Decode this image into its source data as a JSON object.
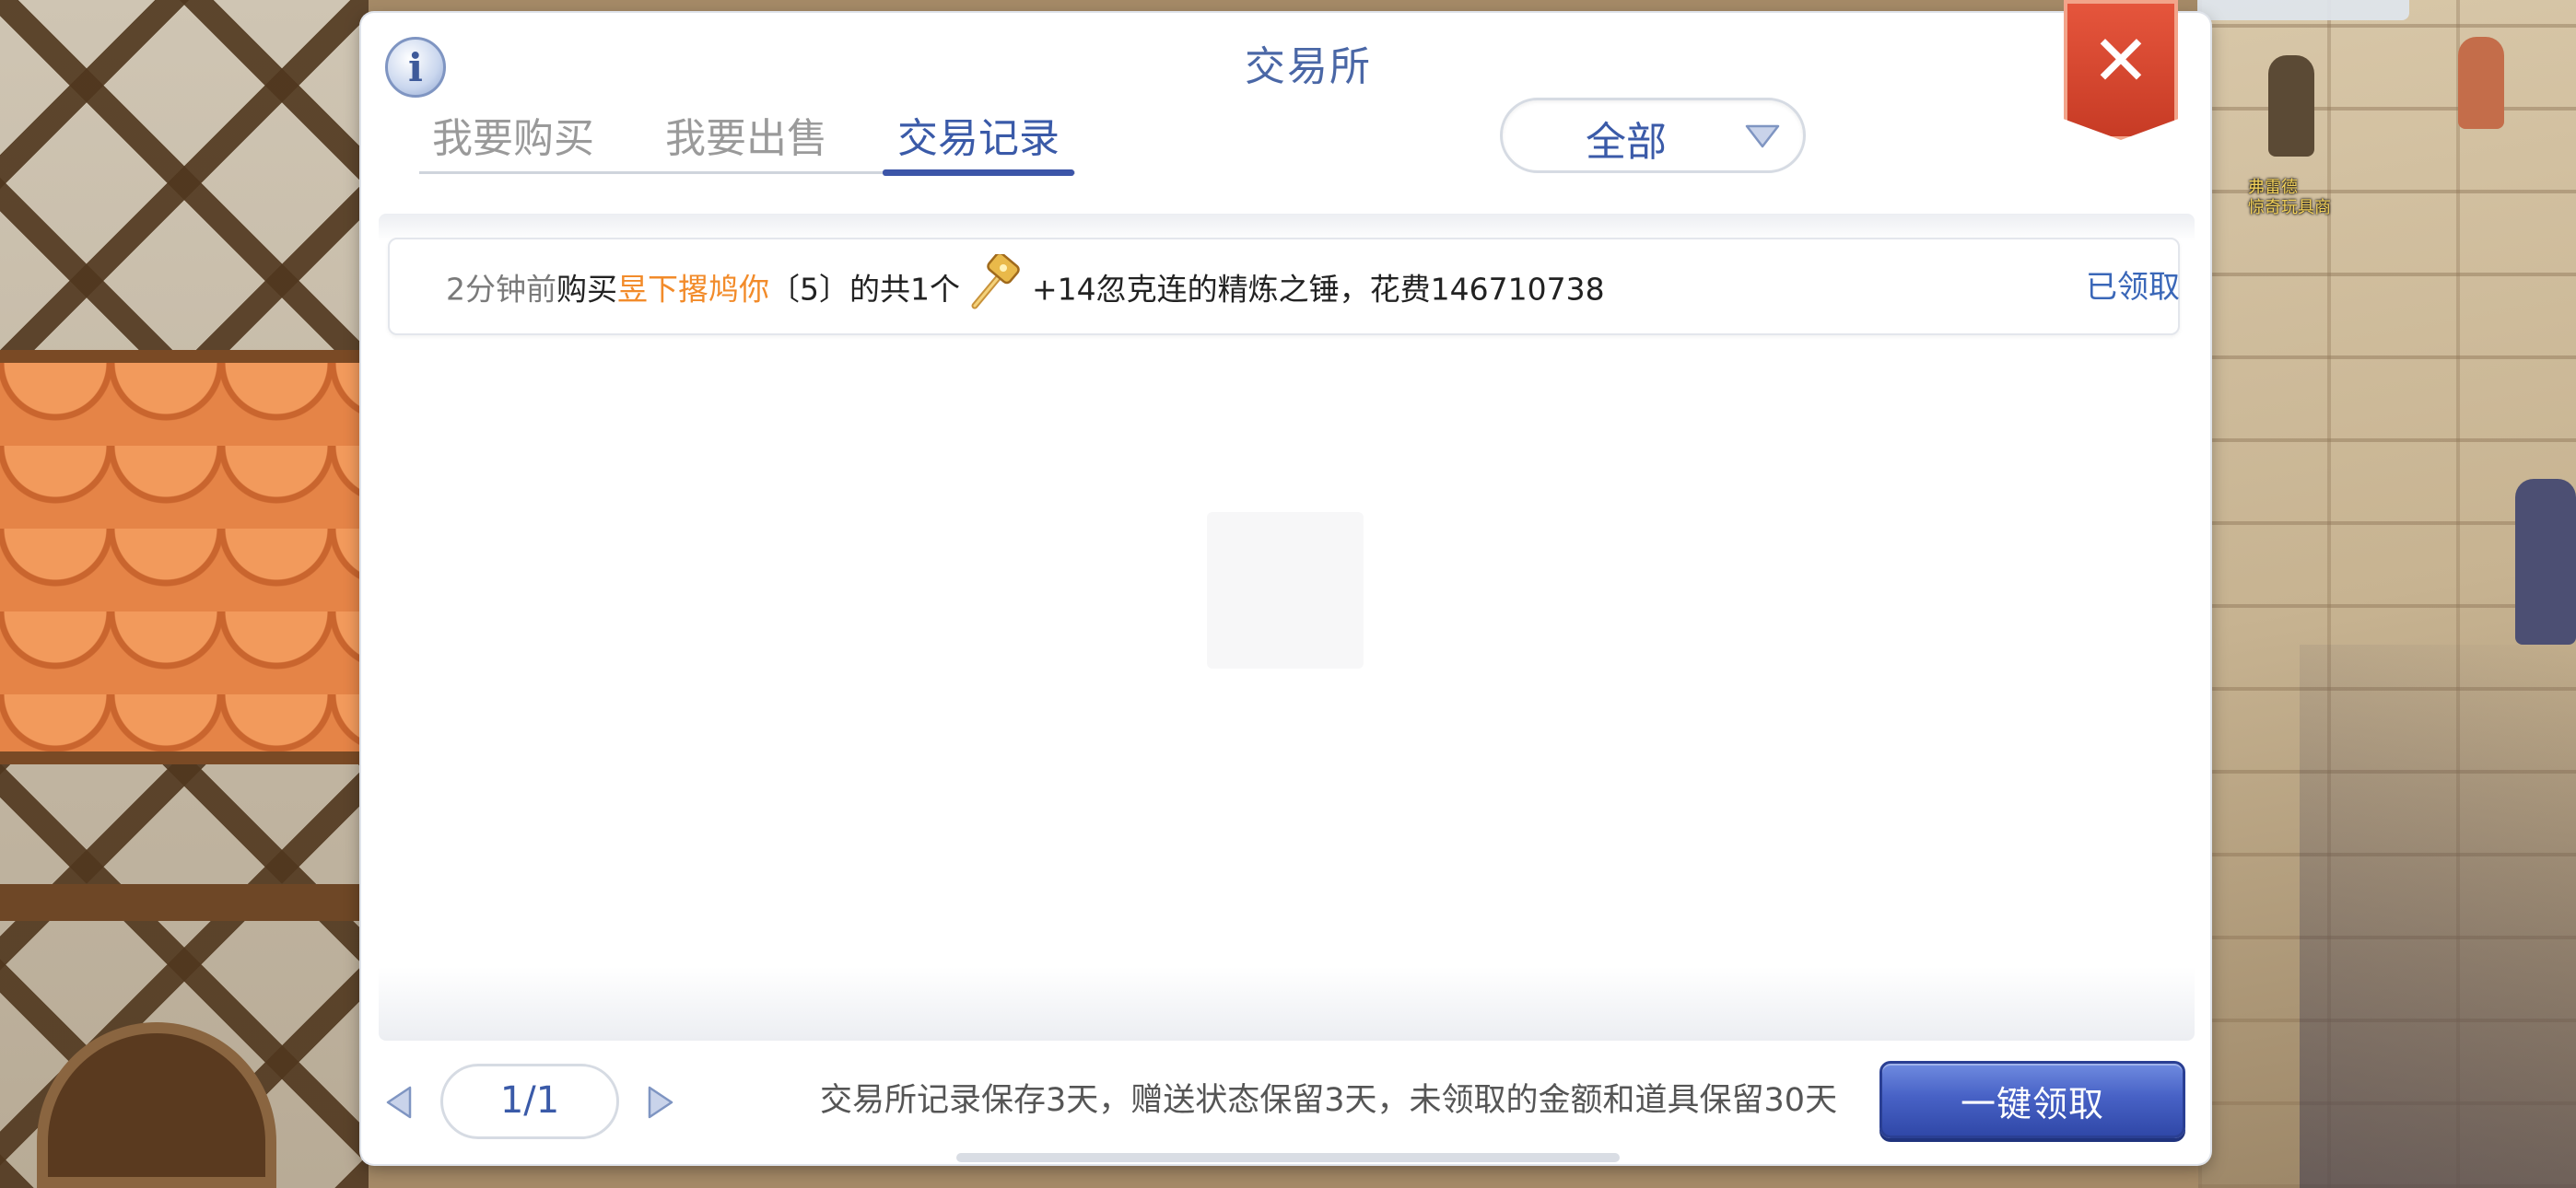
{
  "npc": {
    "name": "弗雷德",
    "shop": "惊奇玩具商"
  },
  "dialog": {
    "title": "交易所",
    "close_symbol": "✕",
    "info_symbol": "i"
  },
  "tabs": [
    {
      "label": "我要购买",
      "active": false
    },
    {
      "label": "我要出售",
      "active": false
    },
    {
      "label": "交易记录",
      "active": true
    }
  ],
  "filter": {
    "selected": "全部"
  },
  "records": [
    {
      "time": "2分钟前",
      "action": "购买",
      "seller": "昱下撂鸠你",
      "bracket_open": "〔",
      "seller_level": "5",
      "bracket_close": "〕",
      "quantity_text": "的共1个",
      "item_text": "+14忽克连的精炼之锤，花费146710738",
      "item_icon": "hammer-icon",
      "status": "已领取"
    }
  ],
  "pagination": {
    "page": "1/1"
  },
  "footer": {
    "notice": "交易所记录保存3天，赠送状态保留3天，未领取的金额和道具保留30天",
    "claim_all_label": "一键领取"
  },
  "colors": {
    "accent": "#3a5aa8",
    "seller": "#f28b2a",
    "close": "#d8452e",
    "claim_button": "#4862c6"
  }
}
